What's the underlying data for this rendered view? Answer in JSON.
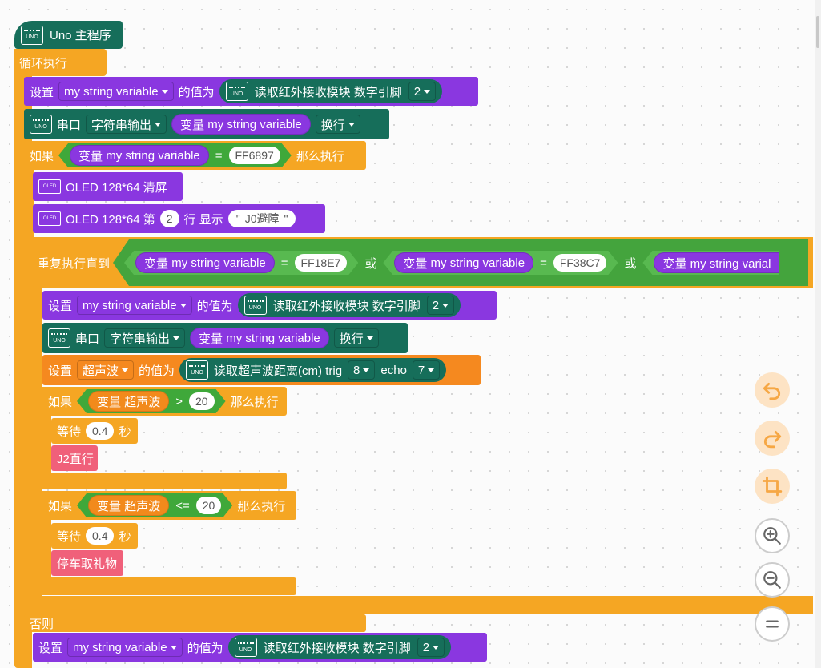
{
  "hat": {
    "label": "Uno 主程序"
  },
  "loop": {
    "label": "循环执行"
  },
  "uno_icon_text": "UNO",
  "oled_icon_text": "OLED",
  "set_label": "设置",
  "value_label": "的值为",
  "ir_read_label": "读取红外接收模块 数字引脚",
  "ir_pin": "2",
  "string_var": "my string variable",
  "var_prefix": "变量",
  "serial": {
    "label": "串口",
    "mode": "字符串输出",
    "newline": "换行"
  },
  "if_label": "如果",
  "then_label": "那么执行",
  "else_label": "否则",
  "eq": "=",
  "or_label": "或",
  "codes": {
    "first": "FF6897",
    "second": "FF18E7",
    "third": "FF38C7"
  },
  "oled": {
    "clear": "OLED 128*64 清屏",
    "show_prefix": "OLED 128*64 第",
    "row": "2",
    "show_suffix": "行 显示",
    "text": "J0避障",
    "quote_open": "\"",
    "quote_close": "\""
  },
  "repeat_until_label": "重复执行直到",
  "truncated_var": "变量 my string varial",
  "ultra": {
    "var": "超声波",
    "read_label": "读取超声波距离(cm) trig",
    "trig": "8",
    "echo_label": "echo",
    "echo": "7"
  },
  "cond1": {
    "op": ">",
    "value": "20"
  },
  "cond2": {
    "op": "<=",
    "value": "20"
  },
  "wait_label": "等待",
  "wait_value": "0.4",
  "seconds_label": "秒",
  "j2_label": "J2直行",
  "stop_label": "停车取礼物",
  "controls": [
    "undo-icon",
    "redo-icon",
    "crop-icon",
    "zoom-in-icon",
    "zoom-out-icon",
    "reset-icon"
  ]
}
